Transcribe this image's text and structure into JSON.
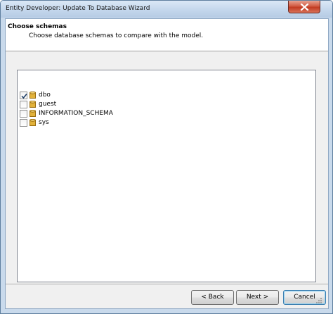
{
  "window": {
    "title": "Entity Developer: Update To Database Wizard"
  },
  "header": {
    "title": "Choose schemas",
    "subtitle": "Choose database schemas to compare with the model."
  },
  "schemas": {
    "items": [
      {
        "label": "dbo",
        "checked": true
      },
      {
        "label": "guest",
        "checked": false
      },
      {
        "label": "INFORMATION_SCHEMA",
        "checked": false
      },
      {
        "label": "sys",
        "checked": false
      }
    ]
  },
  "footer": {
    "back_label": "< Back",
    "next_label": "Next >",
    "cancel_label": "Cancel"
  },
  "icons": {
    "close": "close-icon",
    "checkbox_check": "check-icon",
    "schema": "database-icon"
  },
  "colors": {
    "title_bar": "#c4d7ec",
    "close_button": "#c23b22",
    "icon_gold": "#e2b23a",
    "focus_border": "#3c7fb1"
  }
}
